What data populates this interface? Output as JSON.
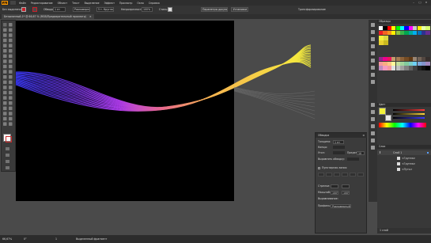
{
  "app": {
    "logo": "Ai"
  },
  "menubar": {
    "items": [
      "Файл",
      "Редактирование",
      "Объект",
      "Текст",
      "Выделение",
      "Эффект",
      "Просмотр",
      "Окно",
      "Справка"
    ]
  },
  "controlbar": {
    "selection_label": "Без выделения",
    "stroke_label": "Обводка:",
    "stroke_value": "1 пт",
    "profile_value": "Равномерный",
    "brush_value": "5 т. Круглая",
    "opacity_label": "Непрозрачность:",
    "opacity_value": "100%",
    "style_label": "Стиль:",
    "doc_settings_button": "Параметры документа",
    "prefs_button": "Установки",
    "transform_label": "Трансформирование"
  },
  "document": {
    "tab_label": "Безымянный-1* @ 66,67 % (RGB/Предварительный просмотр)",
    "close_glyph": "×"
  },
  "panels": {
    "swatches_title": "Образцы",
    "color_title": "Цвет",
    "layers_title": "Слои",
    "layers": [
      {
        "name": "Слой 1"
      },
      {
        "name": "<Группа>"
      },
      {
        "name": "<Группа>"
      },
      {
        "name": "<Путь>"
      }
    ],
    "layers_count": "1 слой"
  },
  "float_panel": {
    "title": "Обводка",
    "weight_label": "Толщина:",
    "weight_value": "1 пт",
    "cap_label": "Концы:",
    "corner_label": "Угол:",
    "limit_label": "Предел:",
    "limit_value": "10",
    "align_label": "Выровнять обводку:",
    "dashed_label": "Пунктирная линия",
    "dash_fields": [
      "штрих",
      "пробел",
      "штрих",
      "пробел",
      "штрих",
      "пробел"
    ],
    "arrow_label": "Стрелки:",
    "scale_label": "Масштаб:",
    "scale_values": [
      "100%",
      "100%"
    ],
    "align2_label": "Выравнивание:",
    "profile_label": "Профиль:",
    "profile_value": "Равномерный"
  },
  "status": {
    "zoom": "66,67%",
    "rotation": "0°",
    "artboard_num": "1",
    "tool_label": "Выделенный фрагмент"
  },
  "colors": {
    "accent": "#ff9a00",
    "canvas": "#000000",
    "wave_start": "#3a3aff",
    "wave_mid": "#c43cff",
    "wave_end": "#f7f23c"
  }
}
